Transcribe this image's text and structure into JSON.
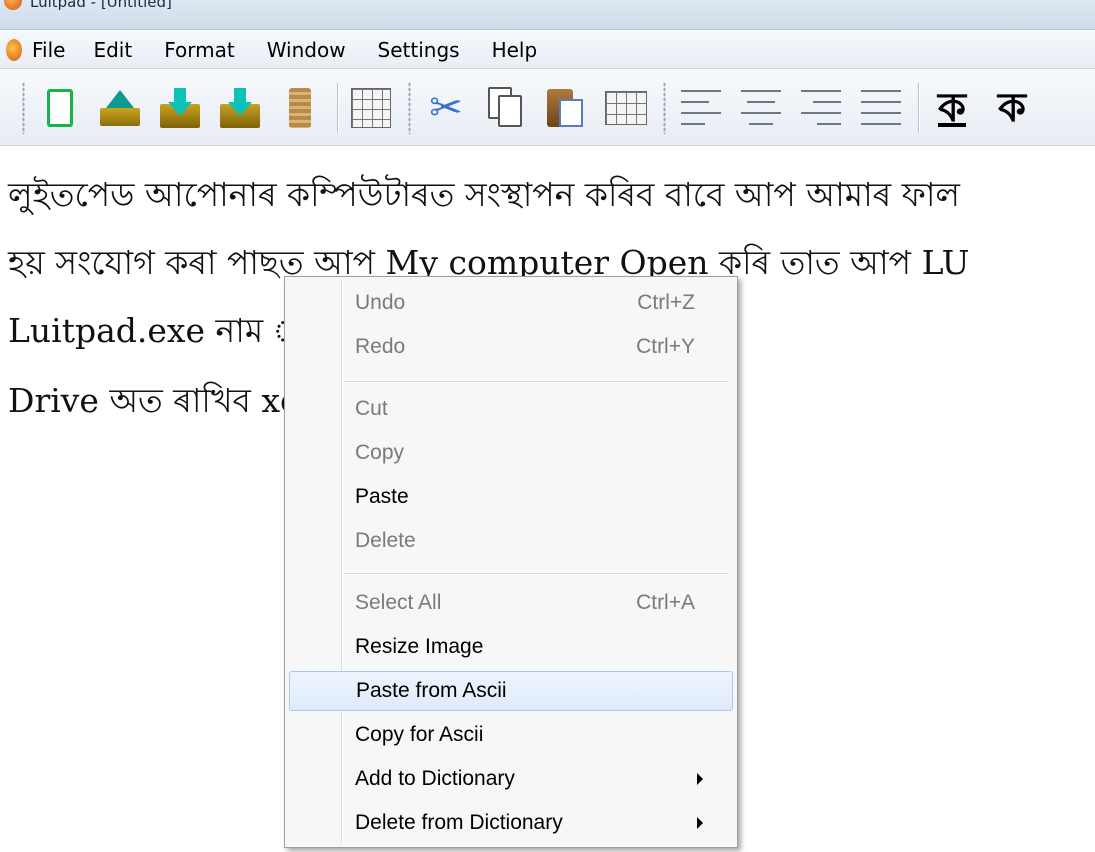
{
  "window": {
    "title": "Luitpad - [Untitled]"
  },
  "menubar": {
    "items": [
      "File",
      "Edit",
      "Format",
      "Window",
      "Settings",
      "Help"
    ]
  },
  "toolbar": {
    "icons": [
      "new-document-icon",
      "open-icon",
      "save-icon",
      "save-as-icon",
      "scroll-icon",
      "keyboard-grid-icon",
      "cut-icon",
      "copy-icon",
      "paste-icon",
      "character-grid-icon",
      "align-left-icon",
      "align-center-icon",
      "align-right-icon",
      "justify-icon"
    ],
    "char_underline": "ক",
    "char_bold": "ক"
  },
  "document": {
    "lines": [
      "লুইতপেড আপোনাৰ কম্পিউটাৰত সংস্থাপন কৰিব বাবে আপ আমাৰ ফাল",
      "হয় সংযোগ কৰা পাছত আপ My computer Open কৰি তাত আপ LU",
      "Luitpad.exe নাম                                          াৰু অলপ সময়ৰ পাছতে",
      "Drive অত ৰাখিব                                           xe ফাইল টোত Right"
    ]
  },
  "context_menu": {
    "items": [
      {
        "label": "Undo",
        "shortcut": "Ctrl+Z",
        "enabled": false
      },
      {
        "label": "Redo",
        "shortcut": "Ctrl+Y",
        "enabled": false
      },
      {
        "label": "Cut",
        "shortcut": "",
        "enabled": false
      },
      {
        "label": "Copy",
        "shortcut": "",
        "enabled": false
      },
      {
        "label": "Paste",
        "shortcut": "",
        "enabled": true
      },
      {
        "label": "Delete",
        "shortcut": "",
        "enabled": false
      },
      {
        "label": "Select All",
        "shortcut": "Ctrl+A",
        "enabled": false
      },
      {
        "label": "Resize Image",
        "shortcut": "",
        "enabled": true
      },
      {
        "label": "Paste from Ascii",
        "shortcut": "",
        "enabled": true,
        "highlighted": true
      },
      {
        "label": "Copy for Ascii",
        "shortcut": "",
        "enabled": true
      },
      {
        "label": "Add to Dictionary",
        "shortcut": "",
        "enabled": true,
        "submenu": true
      },
      {
        "label": "Delete from Dictionary",
        "shortcut": "",
        "enabled": true,
        "submenu": true
      }
    ]
  }
}
